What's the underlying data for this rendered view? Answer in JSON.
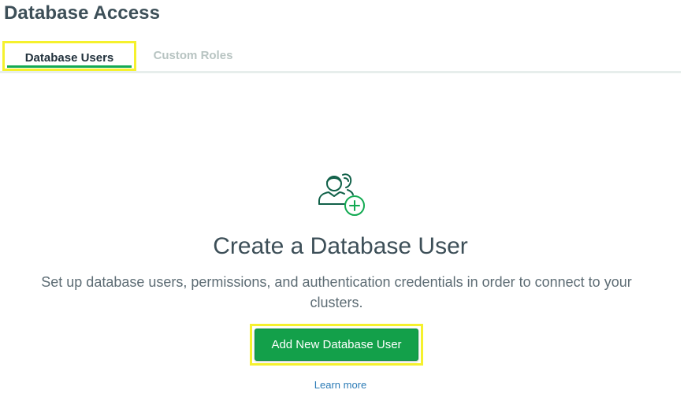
{
  "page": {
    "title": "Database Access"
  },
  "tabs": [
    {
      "label": "Database Users",
      "active": true
    },
    {
      "label": "Custom Roles",
      "active": false
    }
  ],
  "empty_state": {
    "icon": "users-add-icon",
    "title": "Create a Database User",
    "description": "Set up database users, permissions, and authentication credentials in order to connect to your clusters.",
    "button_label": "Add New Database User",
    "link_label": "Learn more"
  },
  "colors": {
    "accent_green": "#13aa52",
    "button_green": "#13a04a",
    "highlight_yellow": "#f5f12d",
    "link_blue": "#2c7bb6",
    "icon_dark_green": "#116149"
  }
}
